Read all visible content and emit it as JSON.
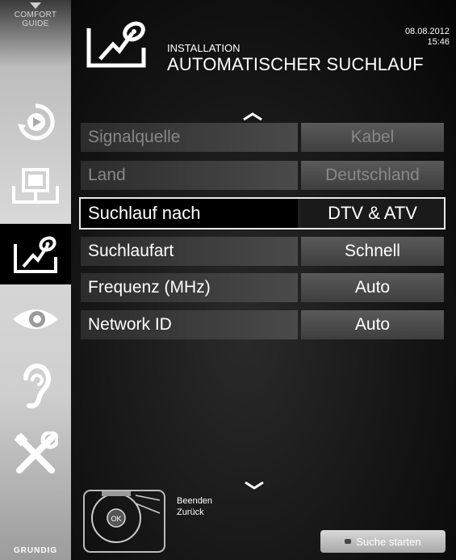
{
  "sidebar": {
    "comfort_line1": "COMFORT",
    "comfort_line2": "GUIDE",
    "brand": "GRUNDIG",
    "items": [
      {
        "icon": "source-icon"
      },
      {
        "icon": "picture-icon"
      },
      {
        "icon": "installation-icon",
        "active": true
      },
      {
        "icon": "eye-icon"
      },
      {
        "icon": "ear-icon"
      },
      {
        "icon": "tools-icon"
      }
    ]
  },
  "header": {
    "subtitle": "INSTALLATION",
    "title": "AUTOMATISCHER SUCHLAUF",
    "date": "08.08.2012",
    "time": "15:46"
  },
  "rows": [
    {
      "label": "Signalquelle",
      "value": "Kabel",
      "state": "disabled"
    },
    {
      "label": "Land",
      "value": "Deutschland",
      "state": "disabled"
    },
    {
      "label": "Suchlauf nach",
      "value": "DTV & ATV",
      "state": "selected"
    },
    {
      "label": "Suchlaufart",
      "value": "Schnell",
      "state": "normal"
    },
    {
      "label": "Frequenz (MHz)",
      "value": "Auto",
      "state": "normal"
    },
    {
      "label": "Network ID",
      "value": "Auto",
      "state": "normal"
    }
  ],
  "footer": {
    "exit_label": "Beenden",
    "back_label": "Zurück",
    "ok_label": "OK",
    "start_label": "Suche starten"
  },
  "colors": {
    "selected_outline": "#e8e8e8",
    "row_value_bg": "#4a4a4a",
    "disabled_text": "#888888"
  }
}
